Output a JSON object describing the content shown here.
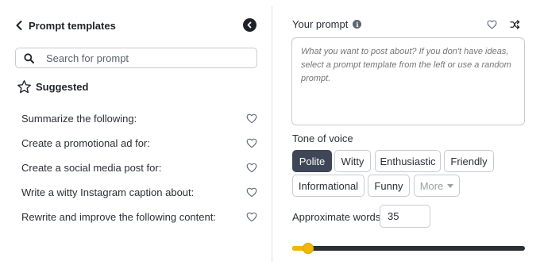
{
  "left_panel": {
    "title": "Prompt templates",
    "search": {
      "placeholder": "Search for prompt",
      "value": ""
    },
    "section_title": "Suggested",
    "templates": [
      {
        "label": "Summarize the following:"
      },
      {
        "label": "Create a promotional ad for:"
      },
      {
        "label": "Create a social media post for:"
      },
      {
        "label": "Write a witty Instagram caption about:"
      },
      {
        "label": "Rewrite and improve the following content:"
      }
    ]
  },
  "right_panel": {
    "prompt_label": "Your prompt",
    "info_glyph": "i",
    "prompt_placeholder": "What you want to post about? If you don't have ideas, select a prompt template from the left or use a random prompt.",
    "prompt_value": "",
    "tone_label": "Tone of voice",
    "tones": [
      {
        "label": "Polite",
        "selected": true
      },
      {
        "label": "Witty",
        "selected": false
      },
      {
        "label": "Enthusiastic",
        "selected": false
      },
      {
        "label": "Friendly",
        "selected": false
      },
      {
        "label": "Informational",
        "selected": false
      },
      {
        "label": "Funny",
        "selected": false
      }
    ],
    "more_label": "More",
    "words_label": "Approximate words",
    "words_value": "35",
    "slider_fraction": 0.045
  },
  "colors": {
    "selected_chip": "#3e4757",
    "slider_accent": "#f2b705",
    "slider_track": "#2b2f36",
    "border": "#c7cbd1"
  },
  "icons": [
    "chevron-left-icon",
    "collapse-left-icon",
    "search-icon",
    "star-icon",
    "heart-icon",
    "info-icon",
    "shuffle-icon",
    "caret-down-icon"
  ]
}
